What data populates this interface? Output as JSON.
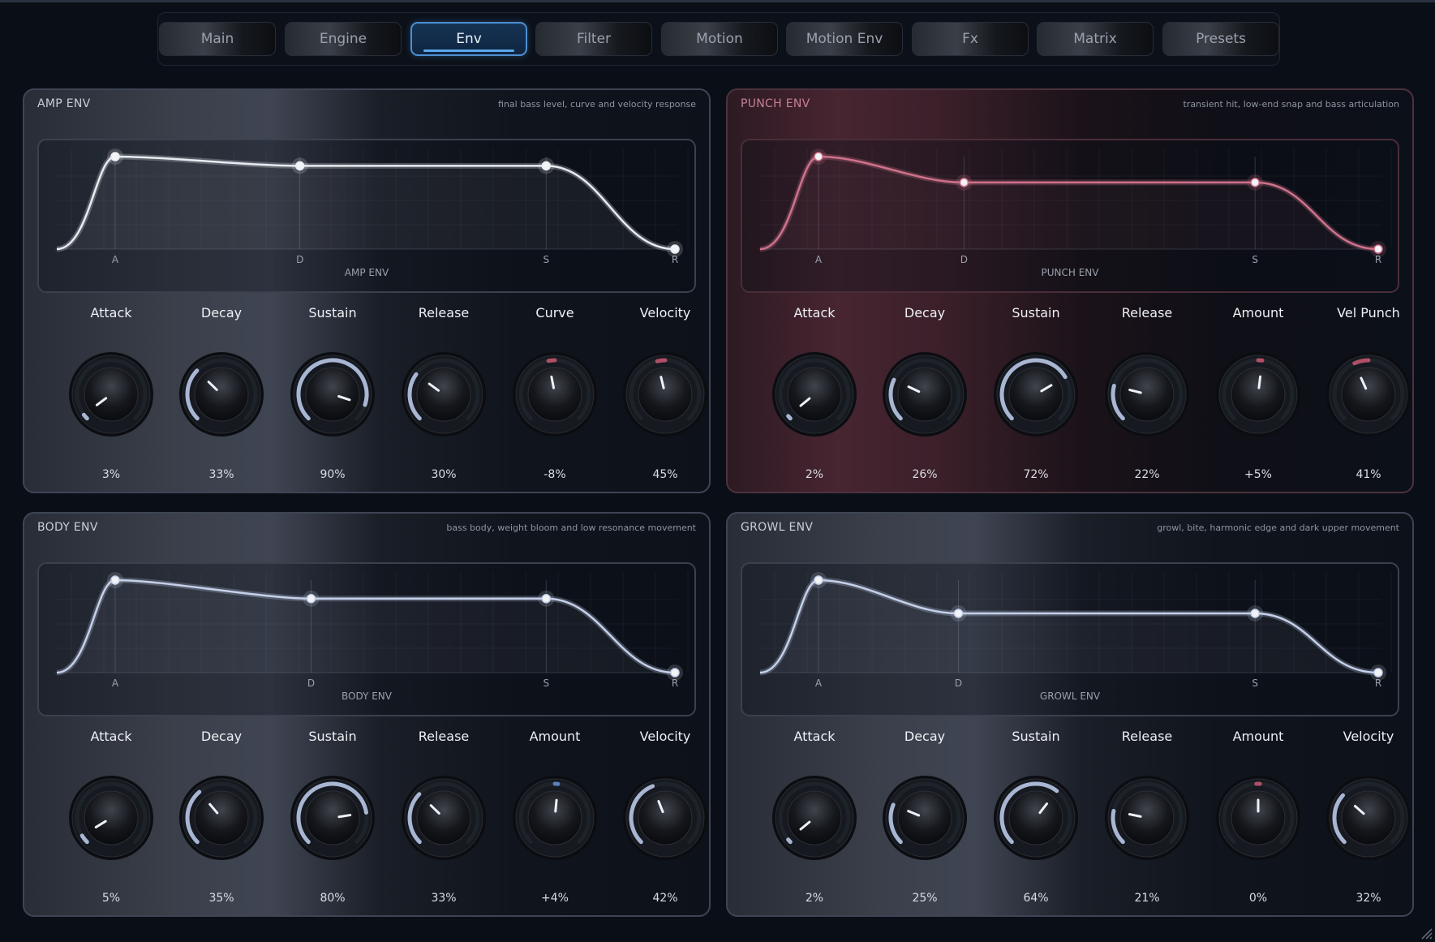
{
  "tabs": [
    "Main",
    "Engine",
    "Env",
    "Filter",
    "Motion",
    "Motion Env",
    "Fx",
    "Matrix",
    "Presets"
  ],
  "active_tab": "Env",
  "colors": {
    "accent": "#5aa7ee",
    "knob_arc_light": "#a9b6d3",
    "knob_arc_pink": "#b04f66",
    "knob_arc_blue": "#5a7fb8",
    "env_curve_gray": "#e8ebf1",
    "env_curve_pink": "#d0728c",
    "env_curve_blue": "#c5d1ea"
  },
  "panels": [
    {
      "title": "AMP ENV",
      "description": "final bass level, curve and velocity response",
      "theme": "gray",
      "graph": {
        "caption": "AMP ENV",
        "stage_labels": [
          "A",
          "D",
          "S",
          "R"
        ],
        "curve_color": "env_curve_gray",
        "levels": {
          "peak": 1.0,
          "sustain": 0.9,
          "decay_pos": 0.33,
          "sustain_end": 0.77
        }
      },
      "knobs": [
        {
          "label": "Attack",
          "value": "3%",
          "fraction": 0.03,
          "arc": "knob_arc_light"
        },
        {
          "label": "Decay",
          "value": "33%",
          "fraction": 0.33,
          "arc": "knob_arc_light"
        },
        {
          "label": "Sustain",
          "value": "90%",
          "fraction": 0.9,
          "arc": "knob_arc_light"
        },
        {
          "label": "Release",
          "value": "30%",
          "fraction": 0.3,
          "arc": "knob_arc_light"
        },
        {
          "label": "Curve",
          "value": "-8%",
          "fraction": 0.46,
          "arc": "knob_arc_pink"
        },
        {
          "label": "Velocity",
          "value": "45%",
          "fraction": 0.45,
          "arc": "knob_arc_pink"
        }
      ]
    },
    {
      "title": "PUNCH ENV",
      "description": "transient hit, low-end snap and bass articulation",
      "theme": "pink",
      "graph": {
        "caption": "PUNCH ENV",
        "stage_labels": [
          "A",
          "D",
          "S",
          "R"
        ],
        "curve_color": "env_curve_pink",
        "levels": {
          "peak": 1.0,
          "sustain": 0.72,
          "decay_pos": 0.26,
          "sustain_end": 0.78
        }
      },
      "knobs": [
        {
          "label": "Attack",
          "value": "2%",
          "fraction": 0.02,
          "arc": "knob_arc_light"
        },
        {
          "label": "Decay",
          "value": "26%",
          "fraction": 0.26,
          "arc": "knob_arc_light"
        },
        {
          "label": "Sustain",
          "value": "72%",
          "fraction": 0.72,
          "arc": "knob_arc_light"
        },
        {
          "label": "Release",
          "value": "22%",
          "fraction": 0.22,
          "arc": "knob_arc_light"
        },
        {
          "label": "Amount",
          "value": "+5%",
          "fraction": 0.525,
          "arc": "knob_arc_pink"
        },
        {
          "label": "Vel Punch",
          "value": "41%",
          "fraction": 0.41,
          "arc": "knob_arc_pink"
        }
      ]
    },
    {
      "title": "BODY ENV",
      "description": "bass body, weight bloom and low resonance movement",
      "theme": "gray",
      "graph": {
        "caption": "BODY ENV",
        "stage_labels": [
          "A",
          "D",
          "S",
          "R"
        ],
        "curve_color": "env_curve_blue",
        "levels": {
          "peak": 1.0,
          "sustain": 0.8,
          "decay_pos": 0.35,
          "sustain_end": 0.77
        }
      },
      "knobs": [
        {
          "label": "Attack",
          "value": "5%",
          "fraction": 0.05,
          "arc": "knob_arc_light"
        },
        {
          "label": "Decay",
          "value": "35%",
          "fraction": 0.35,
          "arc": "knob_arc_light"
        },
        {
          "label": "Sustain",
          "value": "80%",
          "fraction": 0.8,
          "arc": "knob_arc_light"
        },
        {
          "label": "Release",
          "value": "33%",
          "fraction": 0.33,
          "arc": "knob_arc_light"
        },
        {
          "label": "Amount",
          "value": "+4%",
          "fraction": 0.52,
          "arc": "knob_arc_blue"
        },
        {
          "label": "Velocity",
          "value": "42%",
          "fraction": 0.42,
          "arc": "knob_arc_light"
        }
      ]
    },
    {
      "title": "GROWL ENV",
      "description": "growl, bite, harmonic edge and dark upper movement",
      "theme": "gray",
      "graph": {
        "caption": "GROWL ENV",
        "stage_labels": [
          "A",
          "D",
          "S",
          "R"
        ],
        "curve_color": "env_curve_blue",
        "levels": {
          "peak": 1.0,
          "sustain": 0.64,
          "decay_pos": 0.25,
          "sustain_end": 0.78
        }
      },
      "knobs": [
        {
          "label": "Attack",
          "value": "2%",
          "fraction": 0.02,
          "arc": "knob_arc_light"
        },
        {
          "label": "Decay",
          "value": "25%",
          "fraction": 0.25,
          "arc": "knob_arc_light"
        },
        {
          "label": "Sustain",
          "value": "64%",
          "fraction": 0.64,
          "arc": "knob_arc_light"
        },
        {
          "label": "Release",
          "value": "21%",
          "fraction": 0.21,
          "arc": "knob_arc_light"
        },
        {
          "label": "Amount",
          "value": "0%",
          "fraction": 0.5,
          "arc": "knob_arc_pink"
        },
        {
          "label": "Velocity",
          "value": "32%",
          "fraction": 0.32,
          "arc": "knob_arc_light"
        }
      ]
    }
  ]
}
